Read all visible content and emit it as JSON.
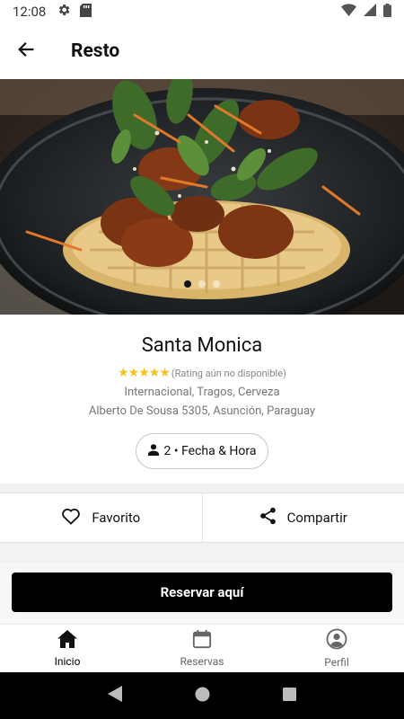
{
  "status_bar": {
    "time": "12:08",
    "icons": [
      "gear-icon",
      "sd-card-icon",
      "wifi-icon",
      "signal-icon",
      "battery-icon"
    ]
  },
  "app_bar": {
    "title": "Resto",
    "back_icon": "arrow-left-icon"
  },
  "hero": {
    "image": "food-photo-chicken-waffle",
    "slide_count": 3,
    "active_slide": 1
  },
  "restaurant": {
    "name": "Santa Monica",
    "stars": "★★★★★",
    "rating_text": "(Rating aún no disponible)",
    "categories": "Internacional, Tragos, Cerveza",
    "address": "Alberto De Sousa 5305, Asunción, Paraguay"
  },
  "party_selector": {
    "label": "2 • Fecha & Hora",
    "icon": "person-icon"
  },
  "actions": {
    "favorite_label": "Favorito",
    "share_label": "Compartir"
  },
  "reserve": {
    "label": "Reservar aquí"
  },
  "bottom_nav": {
    "items": [
      {
        "label": "Inicio",
        "icon": "home-icon",
        "active": true
      },
      {
        "label": "Reservas",
        "icon": "calendar-icon",
        "active": false
      },
      {
        "label": "Perfil",
        "icon": "profile-icon",
        "active": false
      }
    ]
  },
  "colors": {
    "accent": "#000000",
    "stars": "#f3c319"
  }
}
